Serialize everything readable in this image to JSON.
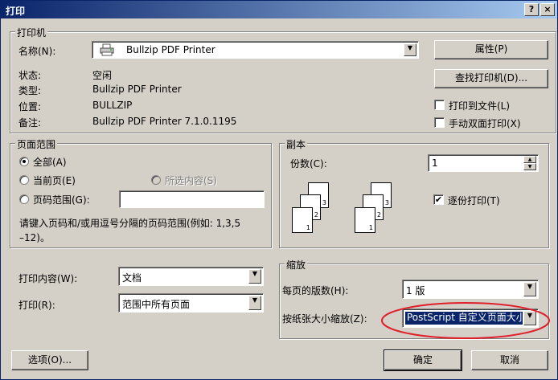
{
  "window": {
    "title": "打印",
    "help_btn": "?",
    "close_btn": "×"
  },
  "printer": {
    "group_label": "打印机",
    "name_label": "名称(N):",
    "name_value": "Bullzip PDF Printer",
    "properties_btn": "属性(P)",
    "find_btn": "查找打印机(D)...",
    "status_label": "状态:",
    "status_value": "空闲",
    "type_label": "类型:",
    "type_value": "Bullzip PDF Printer",
    "where_label": "位置:",
    "where_value": "BULLZIP",
    "comment_label": "备注:",
    "comment_value": "Bullzip PDF Printer 7.1.0.1195",
    "print_to_file_label": "打印到文件(L)",
    "print_to_file_checked": false,
    "duplex_label": "手动双面打印(X)",
    "duplex_checked": false
  },
  "page_range": {
    "group_label": "页面范围",
    "all_label": "全部(A)",
    "current_label": "当前页(E)",
    "selection_label": "所选内容(S)",
    "pages_label": "页码范围(G):",
    "pages_value": "",
    "selected": "all",
    "hint": "请键入页码和/或用逗号分隔的页码范围(例如: 1,3,5–12)。",
    "hint_line1": "请键入页码和/或用逗号分隔的页码范围(例如: 1,3,5",
    "hint_line2": "–12)。"
  },
  "copies": {
    "group_label": "副本",
    "count_label": "份数(C):",
    "count_value": "1",
    "collate_label": "逐份打印(T)",
    "collate_checked": true,
    "page_numbers": [
      "1",
      "2",
      "3"
    ]
  },
  "print_what": {
    "label": "打印内容(W):",
    "value": "文档"
  },
  "print_mode": {
    "label": "打印(R):",
    "value": "范围中所有页面"
  },
  "zoom": {
    "group_label": "缩放",
    "pages_per_sheet_label": "每页的版数(H):",
    "pages_per_sheet_value": "1 版",
    "scale_label": "按纸张大小缩放(Z):",
    "scale_value": "PostScript 自定义页面大小"
  },
  "footer": {
    "options_btn": "选项(O)...",
    "ok_btn": "确定",
    "cancel_btn": "取消"
  },
  "colors": {
    "title_gradient_start": "#0a246a",
    "title_gradient_end": "#a6caf0",
    "face": "#d4d0c8",
    "highlight": "#0a246a",
    "annotation": "#e0202a"
  },
  "icons": {
    "printer": "printer-icon",
    "combo_arrow": "chevron-down-icon",
    "spin_up": "spin-up-icon",
    "spin_down": "spin-down-icon"
  }
}
